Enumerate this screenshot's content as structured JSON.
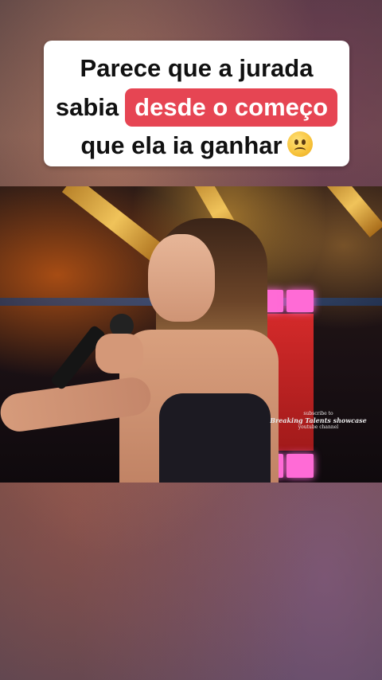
{
  "caption": {
    "line1": "Parece que a jurada",
    "line2_prefix": "sabia",
    "line2_highlight": "desde o começo",
    "line3": "que ela ia ganhar"
  },
  "watermark": {
    "top": "subscribe to",
    "main": "Breaking Talents showcase",
    "bottom": "youtube channel"
  },
  "colors": {
    "highlight": "#e64553",
    "card": "#ffffff"
  },
  "icons": {
    "emoji": "frowning-face-emoji"
  }
}
